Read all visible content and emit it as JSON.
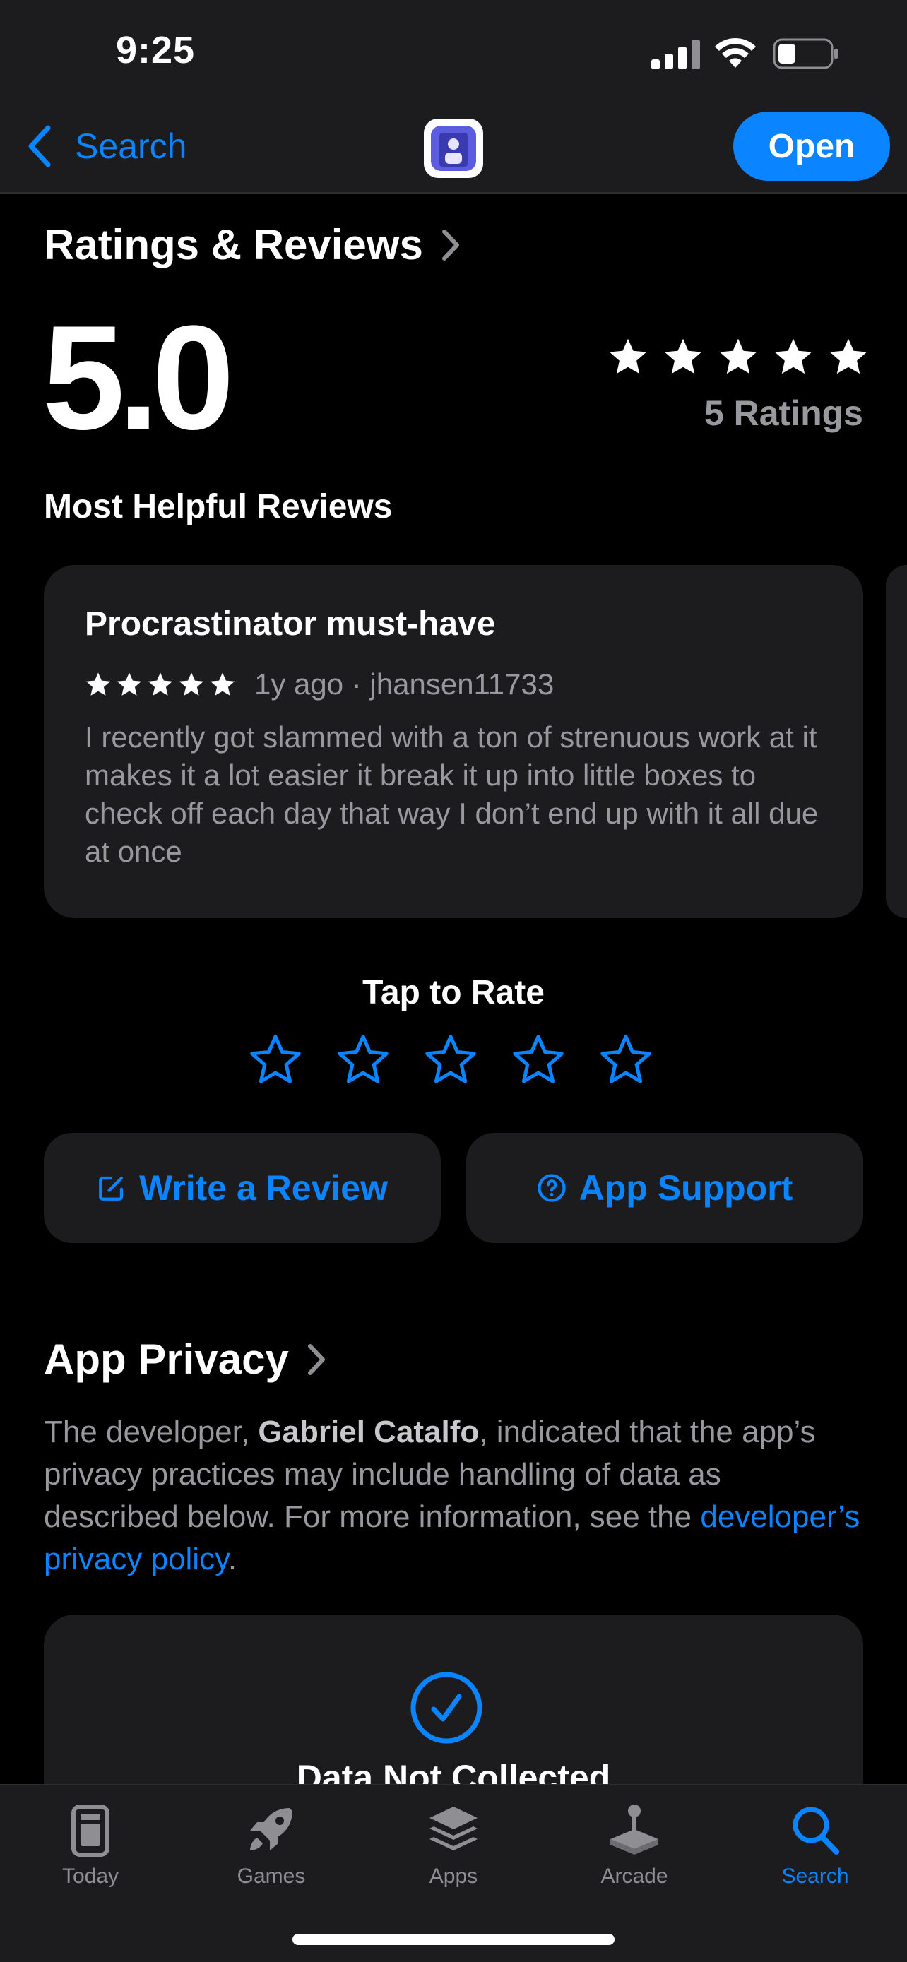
{
  "status_bar": {
    "time": "9:25"
  },
  "nav": {
    "back_label": "Search",
    "open_label": "Open"
  },
  "ratings": {
    "section_title": "Ratings & Reviews",
    "score": "5.0",
    "stars_filled": 5,
    "count_label": "5 Ratings",
    "most_helpful_title": "Most Helpful Reviews"
  },
  "review": {
    "title": "Procrastinator must-have",
    "stars": 5,
    "meta": "1y ago · jhansen11733",
    "body": "I recently got slammed with a ton of strenuous work at it makes it a lot easier it break it up into little boxes to check off each day that way I don’t end up with it all due at once"
  },
  "tap_to_rate": {
    "label": "Tap to Rate",
    "stars": 5
  },
  "actions": {
    "write_review": "Write a Review",
    "app_support": "App Support"
  },
  "privacy": {
    "section_title": "App Privacy",
    "text_before": "The developer, ",
    "developer": "Gabriel Catalfo",
    "text_middle": ", indicated that the app’s privacy practices may include handling of data as described below. For more information, see the ",
    "link_text": "developer’s privacy policy",
    "text_after": ".",
    "card_title": "Data Not Collected"
  },
  "tabs": [
    {
      "label": "Today",
      "icon": "today-icon"
    },
    {
      "label": "Games",
      "icon": "rocket-icon"
    },
    {
      "label": "Apps",
      "icon": "apps-stack-icon"
    },
    {
      "label": "Arcade",
      "icon": "joystick-icon"
    },
    {
      "label": "Search",
      "icon": "search-icon",
      "active": true
    }
  ],
  "colors": {
    "accent": "#0a84ff",
    "background": "#000000",
    "card": "#1c1c1e",
    "secondary_text": "#98989f"
  }
}
